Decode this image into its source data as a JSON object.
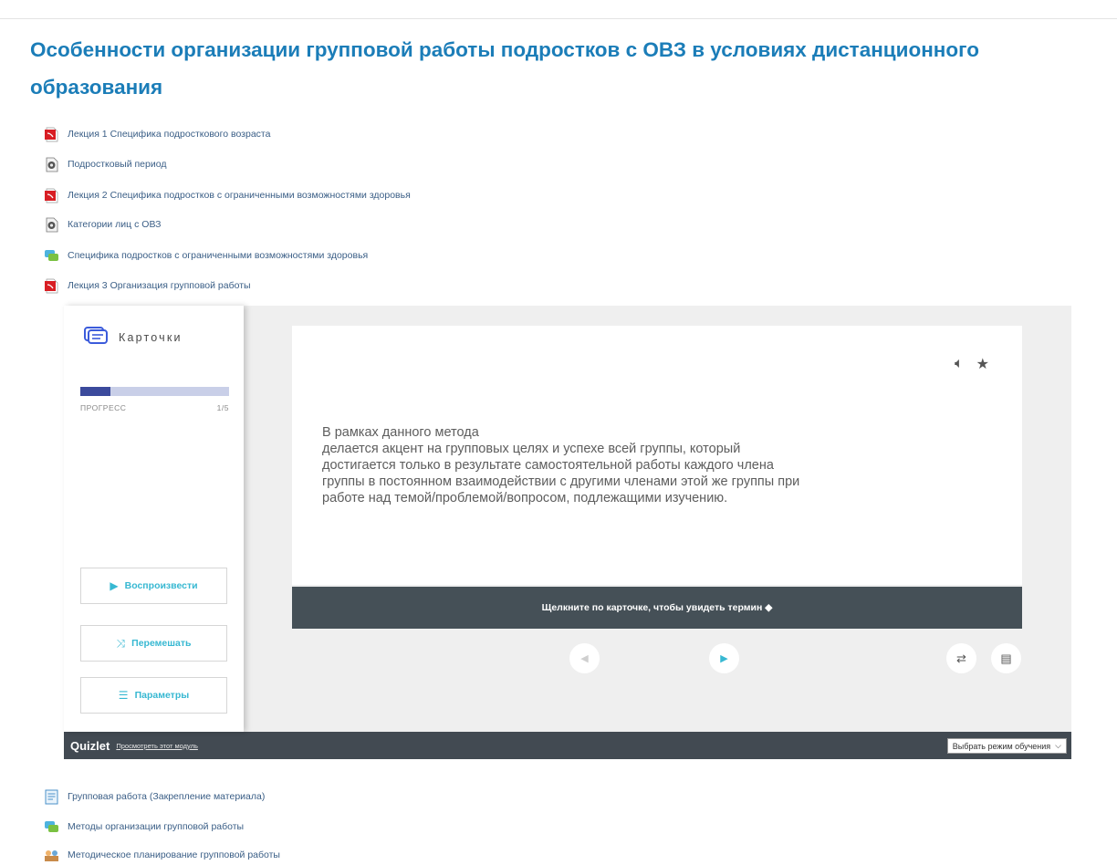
{
  "course": {
    "title": "Особенности организации групповой работы подростков с ОВЗ в условиях дистанционного образования"
  },
  "activities_top": [
    {
      "icon": "pdf-file-icon",
      "label": "Лекция 1 Специфика подросткового возраста"
    },
    {
      "icon": "video-file-icon",
      "label": "Подростковый период"
    },
    {
      "icon": "pdf-file-icon",
      "label": "Лекция 2 Специфика подростков с ограниченными возможностями здоровья"
    },
    {
      "icon": "video-file-icon",
      "label": "Категории лиц с ОВЗ"
    },
    {
      "icon": "forum-icon",
      "label": "Специфика подростков с ограниченными возможностями здоровья"
    },
    {
      "icon": "pdf-file-icon",
      "label": "Лекция 3 Организация групповой работы"
    }
  ],
  "quizlet": {
    "mode_label": "Карточки",
    "progress": {
      "label": "ПРОГРЕСС",
      "count": "1/5",
      "fraction": 0.2
    },
    "buttons": {
      "play": "Воспроизвести",
      "shuffle": "Перемешать",
      "options": "Параметры"
    },
    "card": {
      "text": "В рамках данного метода\nделается акцент на групповых целях и успехе всей группы, который\nдостигается только в результате самостоятельной работы каждого члена\nгруппы в постоянном взаимодействии с другими членами этой же группы при\nработе над темой/проблемой/вопросом, подлежащими изучению.",
      "hint": "Щелкните по карточке, чтобы увидеть термин"
    },
    "footer": {
      "brand": "Quizlet",
      "link": "Просмотреть этот модуль",
      "mode_select": "Выбрать режим обучения"
    },
    "colors": {
      "accent": "#37b8d2",
      "progress": "#3b4a9c",
      "footer": "#424a52",
      "hint_bar": "#455057"
    }
  },
  "activities_bottom": [
    {
      "icon": "assignment-icon",
      "label": "Групповая работа (Закрепление материала)"
    },
    {
      "icon": "forum-icon",
      "label": "Методы организации групповой работы"
    },
    {
      "icon": "workshop-icon",
      "label": "Методическое планирование групповой работы"
    }
  ]
}
